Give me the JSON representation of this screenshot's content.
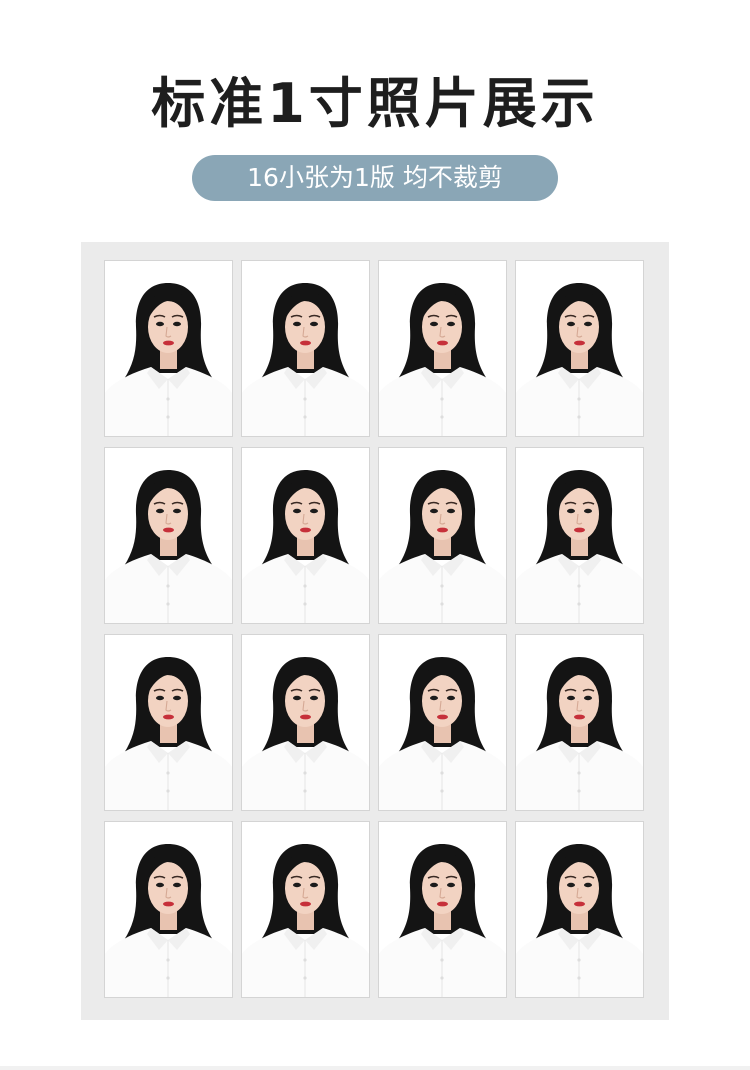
{
  "header": {
    "title": "标准1寸照片展示",
    "subtitle": "16小张为1版 均不裁剪"
  },
  "sheet": {
    "photo_count": 16,
    "columns": 4,
    "rows": 4,
    "photo_subject": "portrait-woman-white-shirt",
    "colors": {
      "background": "#ebebeb",
      "pill": "#8aa6b6",
      "hair": "#141414",
      "skin": "#f2d3c2",
      "lips": "#c6303a",
      "shirt": "#fbfbfb"
    }
  }
}
